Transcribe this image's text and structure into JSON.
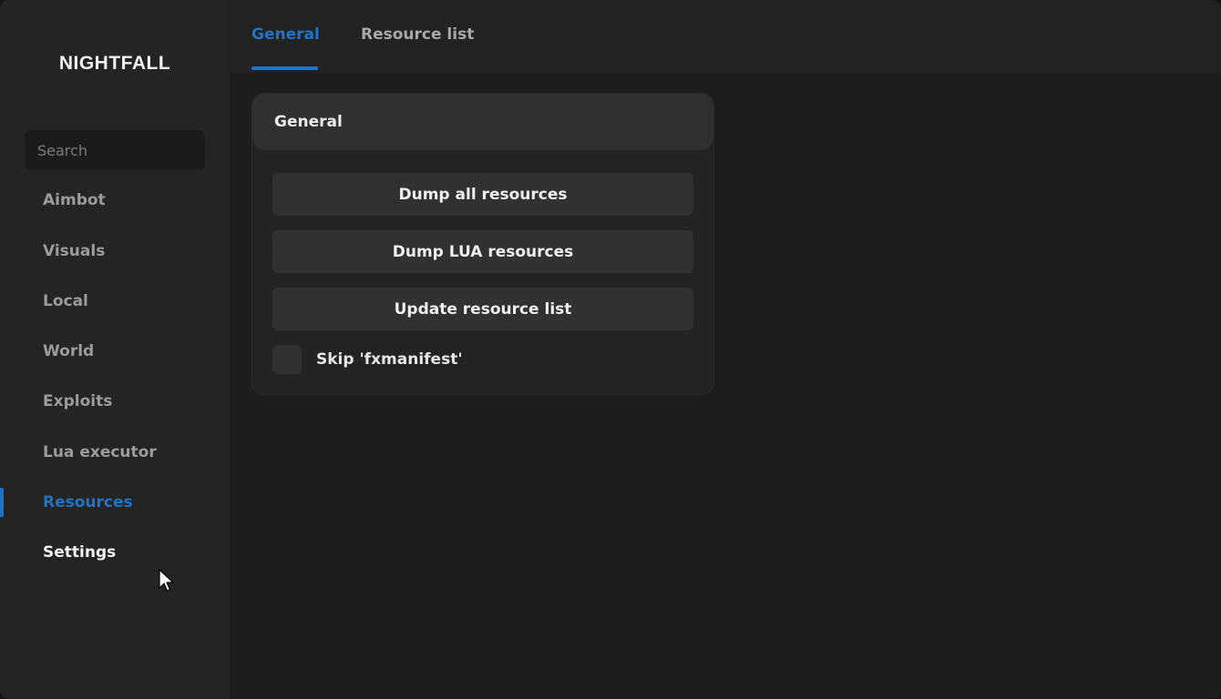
{
  "app": {
    "brand": "NIGHTFALL"
  },
  "sidebar": {
    "search": {
      "placeholder": "Search",
      "value": ""
    },
    "items": [
      {
        "label": "Aimbot"
      },
      {
        "label": "Visuals"
      },
      {
        "label": "Local"
      },
      {
        "label": "World"
      },
      {
        "label": "Exploits"
      },
      {
        "label": "Lua executor"
      },
      {
        "label": "Resources",
        "active": true
      },
      {
        "label": "Settings",
        "hovered": true
      }
    ]
  },
  "tabs": [
    {
      "label": "General",
      "active": true
    },
    {
      "label": "Resource list",
      "active": false
    }
  ],
  "panel": {
    "title": "General",
    "buttons": [
      {
        "label": "Dump all resources"
      },
      {
        "label": "Dump LUA resources"
      },
      {
        "label": "Update resource list"
      }
    ],
    "checkbox": {
      "label": "Skip 'fxmanifest'",
      "checked": false
    }
  },
  "colors": {
    "accent": "#1f74c9",
    "background": "#1d1d1d",
    "sidebar": "#242424",
    "panel": "#232323",
    "panel_header": "#303030",
    "button": "#313131"
  },
  "icons": {
    "cursor": "mouse-pointer-icon"
  }
}
